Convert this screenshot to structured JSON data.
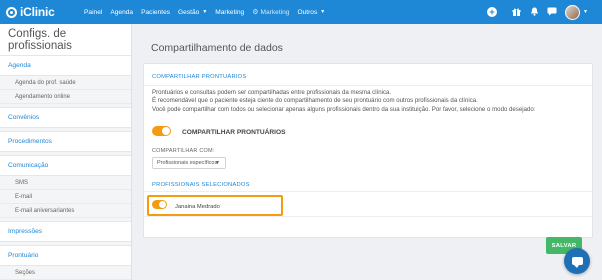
{
  "app": {
    "logo_text": "iClinic"
  },
  "nav": {
    "items": [
      {
        "label": "Painel"
      },
      {
        "label": "Agenda"
      },
      {
        "label": "Pacientes"
      },
      {
        "label": "Gestão"
      },
      {
        "label": "Marketing"
      },
      {
        "label": "Marketing"
      },
      {
        "label": "Outros"
      }
    ],
    "icons": [
      "plus-icon",
      "gift-icon",
      "bell-icon",
      "chat-icon",
      "avatar"
    ]
  },
  "sidebar": {
    "title": "Configs. de profissionais",
    "sections": [
      {
        "label": "Agenda",
        "items": [
          "Agenda do prof. saúde",
          "Agendamento online"
        ]
      },
      {
        "label": "Convênios",
        "items": []
      },
      {
        "label": "Procedimentos",
        "items": []
      },
      {
        "label": "Comunicação",
        "items": [
          "SMS",
          "E-mail",
          "E-mail aniversariantes"
        ]
      },
      {
        "label": "Impressões",
        "items": []
      },
      {
        "label": "Prontuário",
        "items": [
          "Seções"
        ]
      }
    ]
  },
  "main": {
    "page_title": "Compartilhamento de dados",
    "section_title": "COMPARTILHAR PRONTUÁRIOS",
    "description": [
      "Prontuários e consultas podem ser compartilhadas entre profissionais da mesma clínica.",
      "É recomendável que o paciente esteja ciente do compartilhamento de seu prontuário com outros profissionais da clínica.",
      "Você pode compartilhar com todos ou selecionar apenas alguns profissionais dentro da sua instituição. Por favor, selecione o modo desejado:"
    ],
    "share_toggle_label": "COMPARTILHAR PRONTUÁRIOS",
    "share_toggle_on": true,
    "share_with_label": "COMPARTILHAR COM:",
    "share_with_value": "Profissionais específicos",
    "selected_title": "PROFISSIONAIS SELECIONADOS",
    "professionals": [
      {
        "name": "Janaina Medrado",
        "enabled": true
      }
    ],
    "save_label": "SALVAR"
  },
  "colors": {
    "primary": "#1e88d6",
    "accent": "#f39c12",
    "success": "#43b968"
  }
}
